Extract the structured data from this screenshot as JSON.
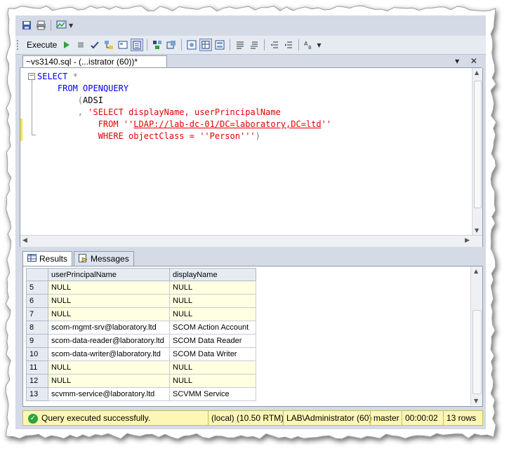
{
  "toolbar": {
    "execute_label": "Execute"
  },
  "document_tab": {
    "title": "~vs3140.sql - (...istrator (60))*",
    "controls": "▾ ✕"
  },
  "editor": {
    "lines": [
      "SELECT *",
      "    FROM OPENQUERY",
      "        (ADSI",
      "        , 'SELECT displayName, userPrincipalName",
      "            FROM ''LDAP://lab-dc-01/DC=laboratory,DC=ltd''",
      "            WHERE objectClass = ''Person''')"
    ]
  },
  "results_tabs": [
    {
      "label": "Results",
      "active": true,
      "icon": "grid-icon"
    },
    {
      "label": "Messages",
      "active": false,
      "icon": "messages-icon"
    }
  ],
  "grid": {
    "columns": [
      "userPrincipalName",
      "displayName"
    ],
    "rows": [
      {
        "num": "5",
        "upn": "NULL",
        "display": "NULL",
        "highlight": true
      },
      {
        "num": "6",
        "upn": "NULL",
        "display": "NULL",
        "highlight": true
      },
      {
        "num": "7",
        "upn": "NULL",
        "display": "NULL",
        "highlight": true
      },
      {
        "num": "8",
        "upn": "scom-mgmt-srv@laboratory.ltd",
        "display": "SCOM Action Account",
        "highlight": false
      },
      {
        "num": "9",
        "upn": "scom-data-reader@laboratory.ltd",
        "display": "SCOM Data Reader",
        "highlight": false
      },
      {
        "num": "10",
        "upn": "scom-data-writer@laboratory.ltd",
        "display": "SCOM Data Writer",
        "highlight": false
      },
      {
        "num": "11",
        "upn": "NULL",
        "display": "NULL",
        "highlight": true
      },
      {
        "num": "12",
        "upn": "NULL",
        "display": "NULL",
        "highlight": true
      },
      {
        "num": "13",
        "upn": "scvmm-service@laboratory.ltd",
        "display": "SCVMM Service",
        "highlight": false
      }
    ]
  },
  "status": {
    "message": "Query executed successfully.",
    "server": "(local) (10.50 RTM)",
    "user": "LAB\\Administrator (60)",
    "database": "master",
    "elapsed": "00:00:02",
    "rows": "13 rows"
  },
  "colors": {
    "status_bg": "#fdf7b5",
    "null_row_bg": "#ffffe1",
    "keyword": "#0000ff",
    "string": "#e00000"
  }
}
